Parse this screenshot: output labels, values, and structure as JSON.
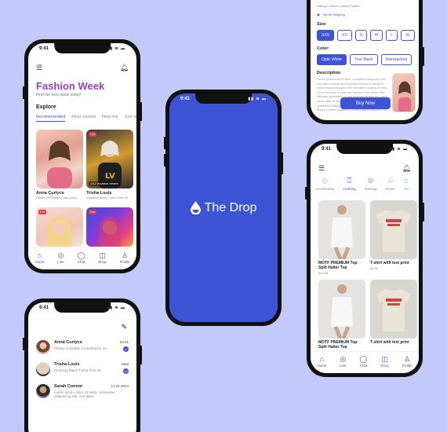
{
  "status_time": "9:41",
  "fashion": {
    "title": "Fashion Week",
    "subtitle": "Find the best deals today!",
    "explore": "Explore",
    "tabs": [
      "Recommended",
      "Most viewed",
      "New live",
      "Just w"
    ],
    "streams": [
      {
        "name": "Anna Curtyce",
        "desc": "Nadier NH Wallet Case (pink)",
        "live": "",
        "views": ""
      },
      {
        "name": "Trisha Louis",
        "desc": "Amazing Black T-shirt Fine 59",
        "live": "Live",
        "views": "4 6,2 thousand viewers"
      },
      {
        "name": "",
        "desc": "",
        "live": "Live",
        "views": ""
      },
      {
        "name": "",
        "desc": "",
        "live": "Live",
        "views": ""
      }
    ]
  },
  "nav": [
    {
      "label": "Home",
      "icon": "home-icon"
    },
    {
      "label": "Live",
      "icon": "live-icon"
    },
    {
      "label": "Chat",
      "icon": "chat-icon"
    },
    {
      "label": "Shop",
      "icon": "bag-icon"
    },
    {
      "label": "Profile",
      "icon": "profile-icon"
    }
  ],
  "messages": [
    {
      "name": "Anna Curtyce",
      "time": "23:01",
      "text": "Please schedule a meeting for us.",
      "badge": "1"
    },
    {
      "name": "Trisha Louis",
      "time": "Wed",
      "text": "Amazing Black T-shirt Fine 59",
      "badge": "12"
    },
    {
      "name": "Sarah Connor",
      "time": "14.02.2023",
      "text": "Lorem ipsum dolor sit amet, consetetur sadipscing elitr, sed diam",
      "badge": ""
    }
  ],
  "brand": {
    "name": "The Drop"
  },
  "product": {
    "sub": "Wilcuyo Cotton V-Neck Pocket",
    "shipping": "+$4.99 Shipping",
    "size_label": "Size:",
    "sizes": [
      "XXS",
      "XS",
      "S",
      "M",
      "L",
      "XL"
    ],
    "color_label": "Color:",
    "colors": [
      "Optic White",
      "True Black",
      "Rainwashed"
    ],
    "desc_label": "Description",
    "desc_text": "Lorem ipsum dolor sit amet, consetetur sadipscing elitr, sed diam nonumy eirmod tempor invidunt ut labore et dolore magna aliquyam erat, sed diam voluptua. At vero eos et accusam et justo duo dolores et ea rebum. Stet clita kasd gubergren, no sea takimata sanctus est Lorem ipsum dolor sit amet. Lorem ipsum dolor sit amet, consetetur sadipscing elitr, sed diam nonumy eirmod tempor invidunt ut labore et dolore magna aliquyam erat, sed diam voluptua. At vero eos et accusam et justo duo dolores et ea rebum. Stet clita kasd gubergren, no sea takimata sanctus est Lorem ipsum dolor sit amet.",
    "buy": "Buy Now"
  },
  "shop": {
    "categories": [
      "Accessories",
      "Clothing",
      "Gaming",
      "Green",
      "Ho"
    ],
    "products": [
      {
        "name": "MOTF PREMIUM Top-Split Halter Top",
        "price": "$10.99"
      },
      {
        "name": "T-shirt with text print",
        "price": "$5.99"
      },
      {
        "name": "MOTF PREMIUM Top-Split Halter Top",
        "price": ""
      },
      {
        "name": "T-shirt with text print",
        "price": ""
      }
    ]
  },
  "colors": {
    "accent": "#3e54d6",
    "title": "#9b3dc9",
    "background": "#c3c9fb",
    "live": "#e63946"
  }
}
